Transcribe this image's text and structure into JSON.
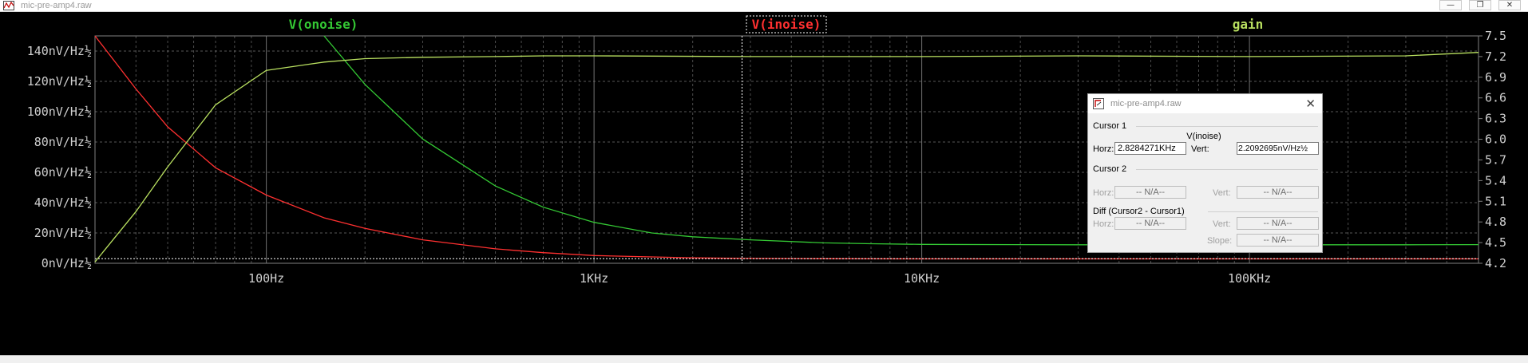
{
  "window": {
    "title": "mic-pre-amp4.raw",
    "minimize_glyph": "—",
    "maximize_glyph": "❐",
    "close_glyph": "✕"
  },
  "plot": {
    "background": "#000000",
    "grid_color": "#7f7f7f",
    "trace_labels": [
      {
        "key": "onoise",
        "text": "V(onoise)",
        "color": "#34c934"
      },
      {
        "key": "inoise",
        "text": "V(inoise)",
        "color": "#ff3030"
      },
      {
        "key": "gain",
        "text": "gain",
        "color": "#b9e060"
      }
    ],
    "left_axis_ticks": [
      "140nV/Hz½",
      "120nV/Hz½",
      "100nV/Hz½",
      "80nV/Hz½",
      "60nV/Hz½",
      "40nV/Hz½",
      "20nV/Hz½",
      "0nV/Hz½"
    ],
    "right_axis_ticks": [
      "7.5",
      "7.2",
      "6.9",
      "6.6",
      "6.3",
      "6.0",
      "5.7",
      "5.4",
      "5.1",
      "4.8",
      "4.5",
      "4.2"
    ],
    "x_axis_ticks": [
      "100Hz",
      "1KHz",
      "10KHz",
      "100KHz"
    ]
  },
  "chart_data": {
    "type": "line",
    "x_scale": "log",
    "xlim": [
      30,
      500000
    ],
    "ylim_left": [
      0,
      150
    ],
    "ylim_right": [
      4.2,
      7.5
    ],
    "x_ticks": [
      "100Hz",
      "1KHz",
      "10KHz",
      "100KHz"
    ],
    "y_ticks_left": [
      "0nV/Hz½",
      "20nV/Hz½",
      "40nV/Hz½",
      "60nV/Hz½",
      "80nV/Hz½",
      "100nV/Hz½",
      "120nV/Hz½",
      "140nV/Hz½"
    ],
    "y_ticks_right": [
      "4.2",
      "4.5",
      "4.8",
      "5.1",
      "5.4",
      "5.7",
      "6.0",
      "6.3",
      "6.6",
      "6.9",
      "7.2",
      "7.5"
    ],
    "grid": true,
    "cursor_x": 2828.4271,
    "series": [
      {
        "name": "V(onoise)",
        "axis": "left",
        "color": "#34c934",
        "x": [
          150,
          200,
          300,
          500,
          700,
          1000,
          1500,
          2000,
          3000,
          5000,
          7000,
          10000,
          30000,
          100000,
          300000,
          500000
        ],
        "y": [
          150,
          118,
          82,
          51,
          37,
          27,
          20,
          17.5,
          15.5,
          13.5,
          12.9,
          12.5,
          12.2,
          12.2,
          12.2,
          12.3
        ]
      },
      {
        "name": "V(inoise)",
        "axis": "left",
        "color": "#ff3030",
        "x": [
          30,
          40,
          50,
          70,
          100,
          150,
          200,
          300,
          500,
          700,
          1000,
          1500,
          2000,
          2828,
          5000,
          10000,
          100000,
          500000
        ],
        "y": [
          150,
          115,
          90,
          63,
          45,
          30,
          23,
          15.5,
          9.5,
          7,
          5.1,
          4.2,
          3.6,
          3.2,
          3,
          2.9,
          2.9,
          2.9
        ]
      },
      {
        "name": "gain",
        "axis": "right",
        "color": "#b9e060",
        "x": [
          30,
          40,
          50,
          70,
          100,
          150,
          200,
          300,
          500,
          700,
          1000,
          3000,
          10000,
          30000,
          100000,
          300000,
          500000
        ],
        "y": [
          4.22,
          4.95,
          5.6,
          6.5,
          7.0,
          7.12,
          7.17,
          7.19,
          7.2,
          7.21,
          7.21,
          7.2,
          7.2,
          7.21,
          7.2,
          7.21,
          7.26
        ]
      }
    ]
  },
  "cursor_dialog": {
    "title": "mic-pre-amp4.raw",
    "close_glyph": "✕",
    "cursor1": {
      "label": "Cursor 1",
      "trace": "V(inoise)",
      "horz_label": "Horz:",
      "horz_value": "2.8284271KHz",
      "vert_label": "Vert:",
      "vert_value": "2.2092695nV/Hz½"
    },
    "cursor2": {
      "label": "Cursor 2",
      "horz_label": "Horz:",
      "horz_value": "-- N/A--",
      "vert_label": "Vert:",
      "vert_value": "-- N/A--"
    },
    "diff": {
      "label": "Diff (Cursor2 - Cursor1)",
      "horz_label": "Horz:",
      "horz_value": "-- N/A--",
      "vert_label": "Vert:",
      "vert_value": "-- N/A--",
      "slope_label": "Slope:",
      "slope_value": "-- N/A--"
    }
  }
}
